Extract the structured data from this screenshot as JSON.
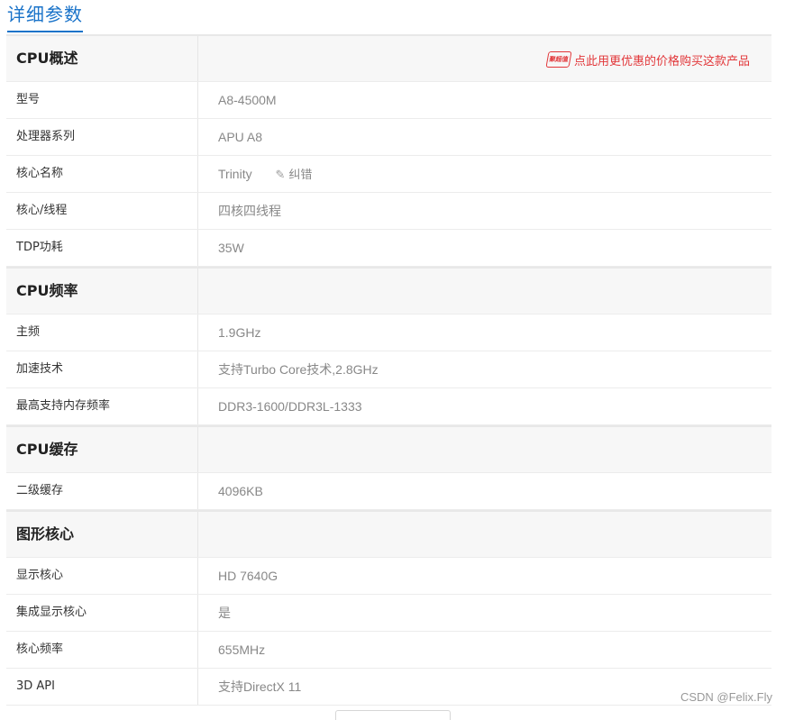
{
  "title": "详细参数",
  "promo": {
    "badge": "聚超值",
    "text": "点此用更优惠的价格购买这款产品"
  },
  "correct": {
    "icon": "pencil-icon",
    "text": "纠错"
  },
  "sections": [
    {
      "name": "CPU概述",
      "rows": [
        {
          "label": "型号",
          "value": "A8-4500M"
        },
        {
          "label": "处理器系列",
          "value": "APU A8"
        },
        {
          "label": "核心名称",
          "value": "Trinity"
        },
        {
          "label": "核心/线程",
          "value": "四核四线程"
        },
        {
          "label": "TDP功耗",
          "value": "35W"
        }
      ]
    },
    {
      "name": "CPU频率",
      "rows": [
        {
          "label": "主频",
          "value": "1.9GHz"
        },
        {
          "label": "加速技术",
          "value": "支持Turbo Core技术,2.8GHz"
        },
        {
          "label": "最高支持内存频率",
          "value": "DDR3-1600/DDR3L-1333"
        }
      ]
    },
    {
      "name": "CPU缓存",
      "rows": [
        {
          "label": "二级缓存",
          "value": "4096KB"
        }
      ]
    },
    {
      "name": "图形核心",
      "rows": [
        {
          "label": "显示核心",
          "value": "HD 7640G"
        },
        {
          "label": "集成显示核心",
          "value": "是"
        },
        {
          "label": "核心频率",
          "value": "655MHz"
        },
        {
          "label": "3D API",
          "value": "支持DirectX 11"
        }
      ]
    }
  ],
  "watermark": "CSDN @Felix.Fly",
  "colors": {
    "accent": "#1a73c9",
    "promo": "#e2373a"
  }
}
